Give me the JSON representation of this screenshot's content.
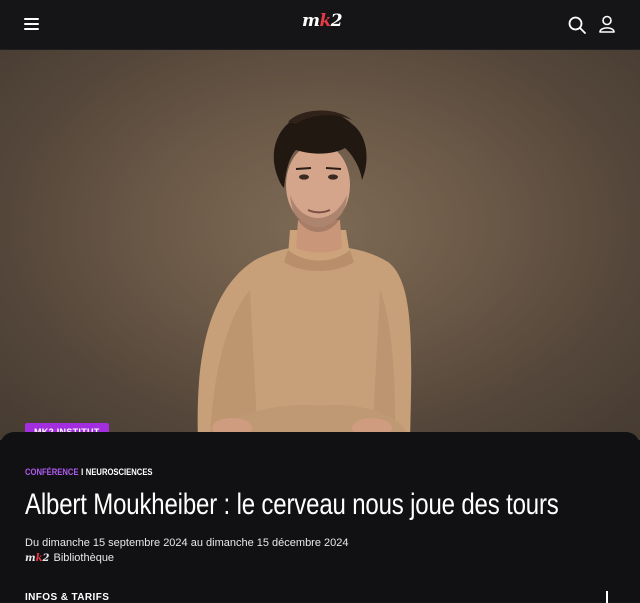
{
  "header": {
    "logo": {
      "prefix": "m",
      "mid": "k",
      "suffix": "2"
    },
    "icons": [
      "menu-icon",
      "search-icon",
      "user-icon"
    ]
  },
  "hero": {
    "image_subject": "portrait-photo"
  },
  "event": {
    "badge": "MK2 INSTITUT",
    "category": "CONFÉRENCE",
    "separator": "I",
    "subcategory": "NEUROSCIENCES",
    "title": "Albert Moukheiber : le cerveau nous joue des tours",
    "dates": "Du dimanche 15 septembre 2024 au dimanche 15 décembre 2024",
    "venue_logo": {
      "prefix": "m",
      "mid": "k",
      "suffix": "2"
    },
    "venue": "Bibliothèque",
    "section_label": "INFOS & TARIFS"
  },
  "colors": {
    "accent": "#a22ee0",
    "logo_red": "#e63946",
    "background": "#111113"
  }
}
